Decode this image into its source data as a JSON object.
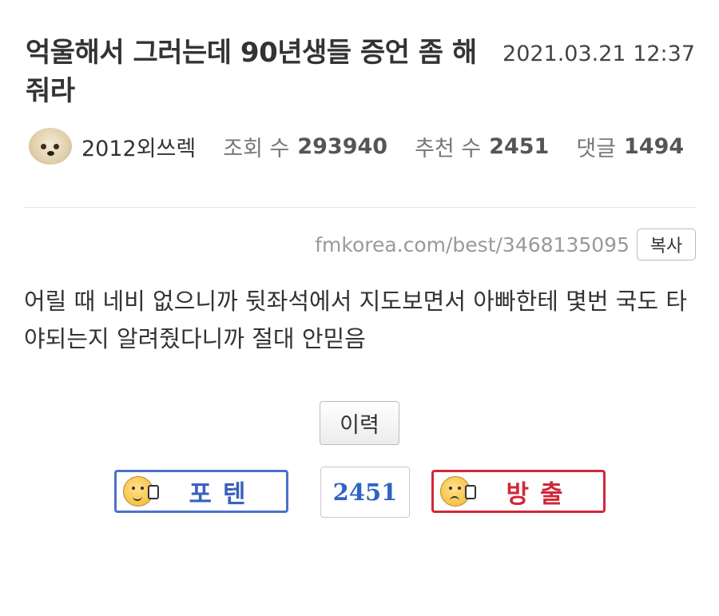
{
  "post": {
    "title": "억울해서 그러는데 90년생들 증언 좀 해줘라",
    "date": "2021.03.21 12:37",
    "author": "2012외쓰렉",
    "views_label": "조회 수",
    "views": "293940",
    "likes_label": "추천 수",
    "likes": "2451",
    "comments_label": "댓글",
    "comments": "1494",
    "url": "fmkorea.com/best/3468135095",
    "copy_label": "복사",
    "body": "어릴 때 네비 없으니까 뒷좌석에서 지도보면서 아빠한테 몇번 국도 타야되는지 알려줬다니까 절대 안믿음"
  },
  "actions": {
    "history_label": "이력",
    "upvote_label": "포텐",
    "vote_count": "2451",
    "downvote_label": "방출"
  },
  "colors": {
    "upvote": "#4a72c9",
    "downvote": "#d1283a",
    "count": "#2f63c4"
  },
  "icons": {
    "avatar": "puppy-avatar",
    "upvote": "thumbs-up-face-icon",
    "downvote": "thumbs-down-face-icon"
  }
}
